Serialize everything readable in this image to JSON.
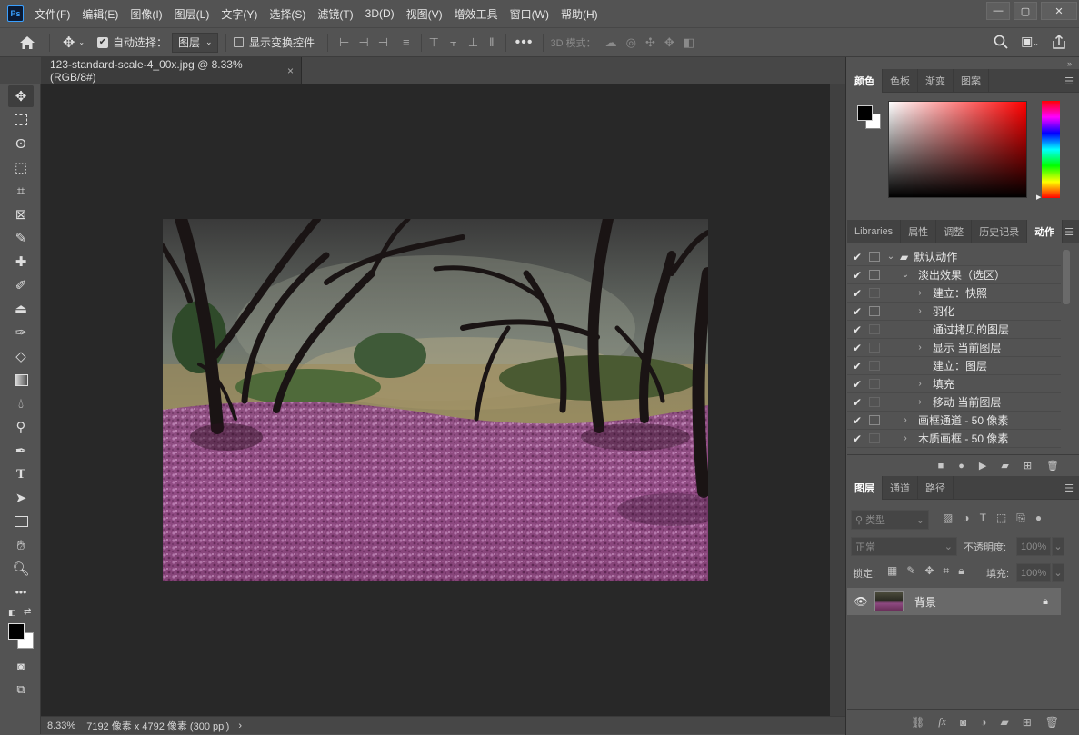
{
  "app": {
    "logo": "Ps"
  },
  "menu": [
    "文件(F)",
    "编辑(E)",
    "图像(I)",
    "图层(L)",
    "文字(Y)",
    "选择(S)",
    "滤镜(T)",
    "3D(D)",
    "视图(V)",
    "增效工具",
    "窗口(W)",
    "帮助(H)"
  ],
  "options": {
    "auto_select_label": "自动选择：",
    "auto_select_target": "图层",
    "show_transform_label": "显示变换控件",
    "mode3d_label": "3D 模式："
  },
  "document": {
    "tab_title": "123-standard-scale-4_00x.jpg @ 8.33%(RGB/8#)",
    "close": "×"
  },
  "status": {
    "zoom": "8.33%",
    "info": "7192 像素 x 4792 像素 (300 ppi)",
    "arrow": "›"
  },
  "color_panel": {
    "tabs": [
      "颜色",
      "色板",
      "渐变",
      "图案"
    ],
    "active": "颜色"
  },
  "actions_panel": {
    "tabs": [
      "Libraries",
      "属性",
      "调整",
      "历史记录",
      "动作"
    ],
    "active": "动作",
    "rows": [
      {
        "label": "默认动作",
        "indent": 0,
        "expand": "down",
        "folder": true,
        "box": true
      },
      {
        "label": "淡出效果（选区）",
        "indent": 1,
        "expand": "down",
        "folder": false,
        "box": true
      },
      {
        "label": "建立：快照",
        "indent": 2,
        "expand": "right",
        "folder": false,
        "box": false
      },
      {
        "label": "羽化",
        "indent": 2,
        "expand": "right",
        "folder": false,
        "box": true
      },
      {
        "label": "通过拷贝的图层",
        "indent": 2,
        "expand": "",
        "folder": false,
        "box": false
      },
      {
        "label": "显示 当前图层",
        "indent": 2,
        "expand": "right",
        "folder": false,
        "box": false
      },
      {
        "label": "建立：图层",
        "indent": 2,
        "expand": "",
        "folder": false,
        "box": false
      },
      {
        "label": "填充",
        "indent": 2,
        "expand": "right",
        "folder": false,
        "box": false
      },
      {
        "label": "移动 当前图层",
        "indent": 2,
        "expand": "right",
        "folder": false,
        "box": false
      },
      {
        "label": "画框通道 - 50 像素",
        "indent": 1,
        "expand": "right",
        "folder": false,
        "box": true
      },
      {
        "label": "木质画框 - 50 像素",
        "indent": 1,
        "expand": "right",
        "folder": false,
        "box": false
      }
    ]
  },
  "layers_panel": {
    "tabs": [
      "图层",
      "通道",
      "路径"
    ],
    "active": "图层",
    "filter_placeholder": "类型",
    "blend_mode": "正常",
    "opacity_label": "不透明度:",
    "opacity_value": "100%",
    "lock_label": "锁定:",
    "fill_label": "填充:",
    "fill_value": "100%",
    "layers": [
      {
        "name": "背景",
        "visible": true,
        "locked": true
      }
    ]
  },
  "colors": {
    "bg": "#535353",
    "canvas": "#282828",
    "panel_tab": "#424242",
    "accent": "#3aa0ff"
  }
}
